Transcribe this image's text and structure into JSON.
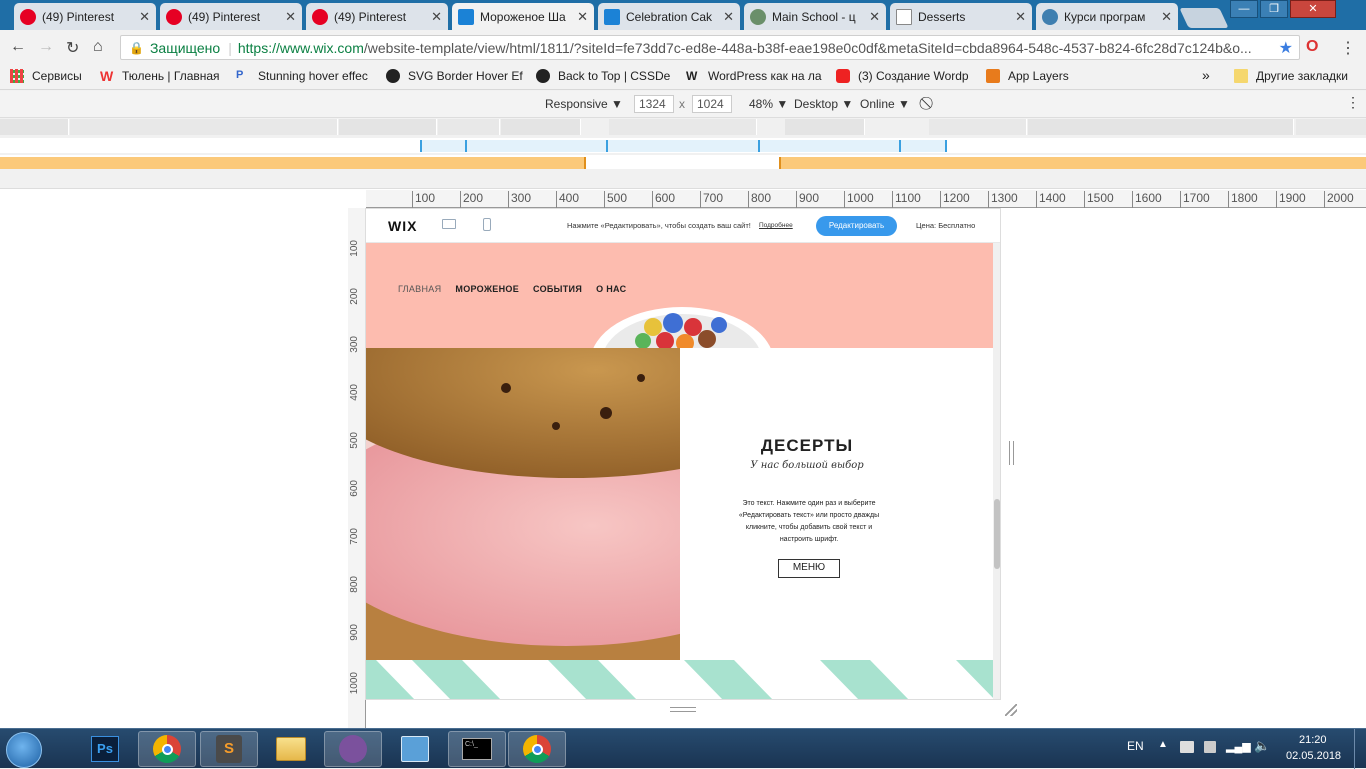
{
  "tabs": [
    {
      "label": "(49) Pinterest",
      "icon": "pinterest-icon"
    },
    {
      "label": "(49) Pinterest",
      "icon": "pinterest-icon"
    },
    {
      "label": "(49) Pinterest",
      "icon": "pinterest-icon"
    },
    {
      "label": "Мороженое Ша",
      "icon": "wix-icon"
    },
    {
      "label": "Celebration Cak",
      "icon": "wix-icon"
    },
    {
      "label": "Main School - ц",
      "icon": "globe-icon"
    },
    {
      "label": "Desserts",
      "icon": "page-icon"
    },
    {
      "label": "Курси програм",
      "icon": "globe-icon"
    }
  ],
  "window": {
    "minimize": "—",
    "maximize": "❐",
    "close": "✕"
  },
  "omnibox": {
    "secure_label": "Защищено",
    "url_host": "https://www.wix.com",
    "url_path": "/website-template/view/html/1811/?siteId=fe73dd7c-ed8e-448a-b38f-eae198e0c0df&metaSiteId=cbda8964-548c-4537-b824-6fc28d7c124b&o..."
  },
  "bookmarks": {
    "items": [
      {
        "label": "Сервисы"
      },
      {
        "label": "Тюлень | Главная"
      },
      {
        "label": "Stunning hover effec"
      },
      {
        "label": "SVG Border Hover Ef"
      },
      {
        "label": "Back to Top | CSSDe"
      },
      {
        "label": "WordPress как на ла"
      },
      {
        "label": "(3) Создание Wordp"
      },
      {
        "label": "App Layers"
      }
    ],
    "more": "»",
    "other": "Другие закладки"
  },
  "devtools": {
    "device": "Responsive ▼",
    "width": "1324",
    "times": "x",
    "height": "1024",
    "zoom": "48% ▼",
    "mode": "Desktop ▼",
    "network": "Online ▼"
  },
  "ruler": {
    "h_labels": [
      "100",
      "200",
      "300",
      "400",
      "500",
      "600",
      "700",
      "800",
      "900",
      "1000",
      "1100",
      "1200",
      "1300",
      "1400",
      "1500",
      "1600",
      "1700",
      "1800",
      "1900",
      "2000"
    ],
    "v_labels": [
      "100",
      "200",
      "300",
      "400",
      "500",
      "600",
      "700",
      "800",
      "900",
      "1000"
    ]
  },
  "wixbar": {
    "logo": "WIX",
    "message": "Нажмите «Редактировать», чтобы создать ваш сайт!",
    "more_link": "Подробнее",
    "edit_button": "Редактировать",
    "price": "Цена: Бесплатно"
  },
  "site": {
    "nav": [
      "ГЛАВНАЯ",
      "МОРОЖЕНОЕ",
      "СОБЫТИЯ",
      "О НАС"
    ],
    "heading": "ДЕСЕРТЫ",
    "subheading": "У нас большой выбор",
    "paragraph": "Это текст. Нажмите один раз и выберите «Редактировать текст» или просто дважды кликните, чтобы добавить свой текст и настроить шрифт.",
    "menu_button": "МЕНЮ"
  },
  "taskbar": {
    "lang": "EN",
    "time": "21:20",
    "date": "02.05.2018",
    "apps": [
      "start-orb-icon",
      "photoshop-icon",
      "chrome-icon",
      "sublime-text-icon",
      "file-explorer-icon",
      "viber-icon",
      "control-panel-icon",
      "cmd-icon",
      "chrome-icon"
    ]
  },
  "colors": {
    "hero_pink": "#fdbcaf",
    "mint": "#a8e2cf",
    "wix_blue": "#3899ec",
    "secure_green": "#0b8043"
  }
}
